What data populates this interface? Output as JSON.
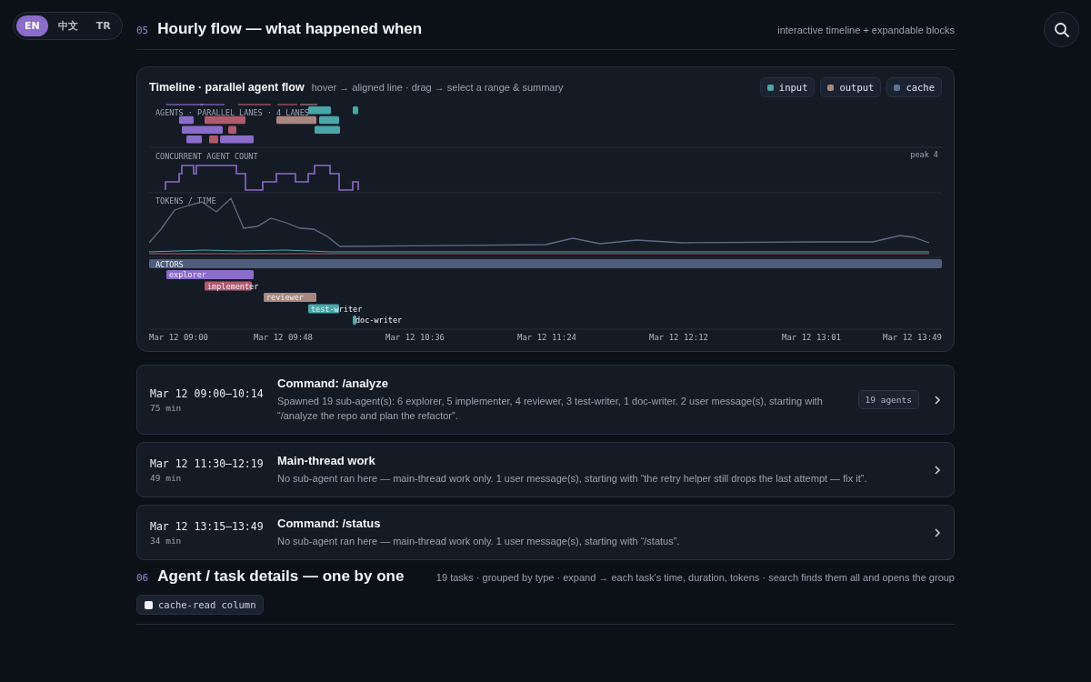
{
  "lang_switch": [
    {
      "label": "EN",
      "selected": true
    },
    {
      "label": "中文",
      "selected": false
    },
    {
      "label": "TR",
      "selected": false
    }
  ],
  "sections": [
    {
      "number": "05",
      "title": "Hourly flow — what happened when",
      "subtitle": "interactive timeline + expandable blocks",
      "timeline": {
        "title": "Timeline · parallel agent flow",
        "hint": "hover → aligned line · drag → select a range & summary",
        "legend": [
          {
            "label": "input",
            "color": "#4aa6a8"
          },
          {
            "label": "output",
            "color": "#a8877f"
          },
          {
            "label": "cache",
            "color": "#5e7394"
          }
        ],
        "lanes_label": "AGENTS · PARALLEL LANES · 4 LANES",
        "count_label": "CONCURRENT AGENT COUNT",
        "peak": "peak 4",
        "tokens_label": "TOKENS / TIME",
        "actors_label": "ACTORS",
        "actors": [
          {
            "name": "explorer",
            "color": "#8b6cc9"
          },
          {
            "name": "implementer",
            "color": "#b05a6e"
          },
          {
            "name": "reviewer",
            "color": "#a8877f"
          },
          {
            "name": "test-writer",
            "color": "#4aa6a8"
          },
          {
            "name": "doc-writer",
            "color": "#4aa6a8"
          }
        ],
        "x_labels": [
          "Mar 12 09:00",
          "Mar 12 09:48",
          "Mar 12 10:36",
          "Mar 12 11:24",
          "Mar 12 12:12",
          "Mar 12 13:01",
          "Mar 12 13:49"
        ]
      },
      "blocks": [
        {
          "time": "Mar 12 09:00–10:14",
          "duration": "75 min",
          "title": "Command: /analyze",
          "description": "Spawned 19 sub-agent(s): 6 explorer, 5 implementer, 4 reviewer, 3 test-writer, 1 doc-writer. 2 user message(s), starting with “/analyze the repo and plan the refactor”.",
          "badge": "19 agents"
        },
        {
          "time": "Mar 12 11:30–12:19",
          "duration": "49 min",
          "title": "Main-thread work",
          "description": "No sub-agent ran here — main-thread work only. 1 user message(s), starting with “the retry helper still drops the last attempt — fix it”."
        },
        {
          "time": "Mar 12 13:15–13:49",
          "duration": "34 min",
          "title": "Command: /status",
          "description": "No sub-agent ran here — main-thread work only. 1 user message(s), starting with “/status”."
        }
      ]
    },
    {
      "number": "06",
      "title": "Agent / task details — one by one",
      "subtitle": "19 tasks · grouped by type · expand → each task's time, duration, tokens · search finds them all and opens the group",
      "toggles": [
        {
          "label": "cache-read column",
          "checked": false
        }
      ]
    }
  ]
}
